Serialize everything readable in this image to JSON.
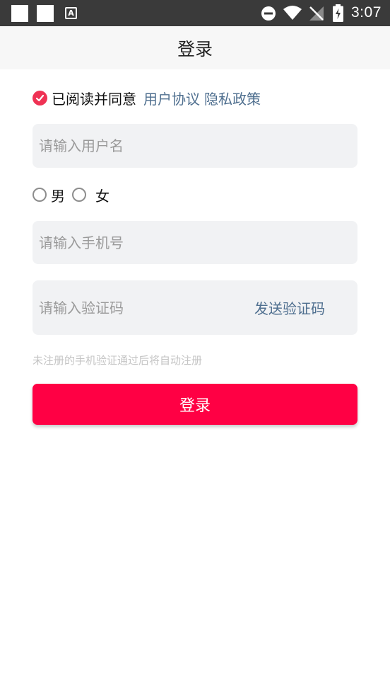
{
  "status_bar": {
    "time": "3:07",
    "a_icon_text": "A"
  },
  "title": "登录",
  "agreement": {
    "text": "已阅读并同意",
    "user_agreement": "用户协议",
    "privacy_policy": "隐私政策",
    "checked": true
  },
  "username": {
    "placeholder": "请输入用户名",
    "value": ""
  },
  "gender": {
    "male": "男",
    "female": "女"
  },
  "phone": {
    "placeholder": "请输入手机号",
    "value": ""
  },
  "code": {
    "placeholder": "请输入验证码",
    "value": "",
    "send_label": "发送验证码"
  },
  "hint": "未注册的手机验证通过后将自动注册",
  "login_button": "登录",
  "colors": {
    "accent": "#ff0044",
    "check": "#ef3254",
    "link": "#4f6f8f"
  }
}
